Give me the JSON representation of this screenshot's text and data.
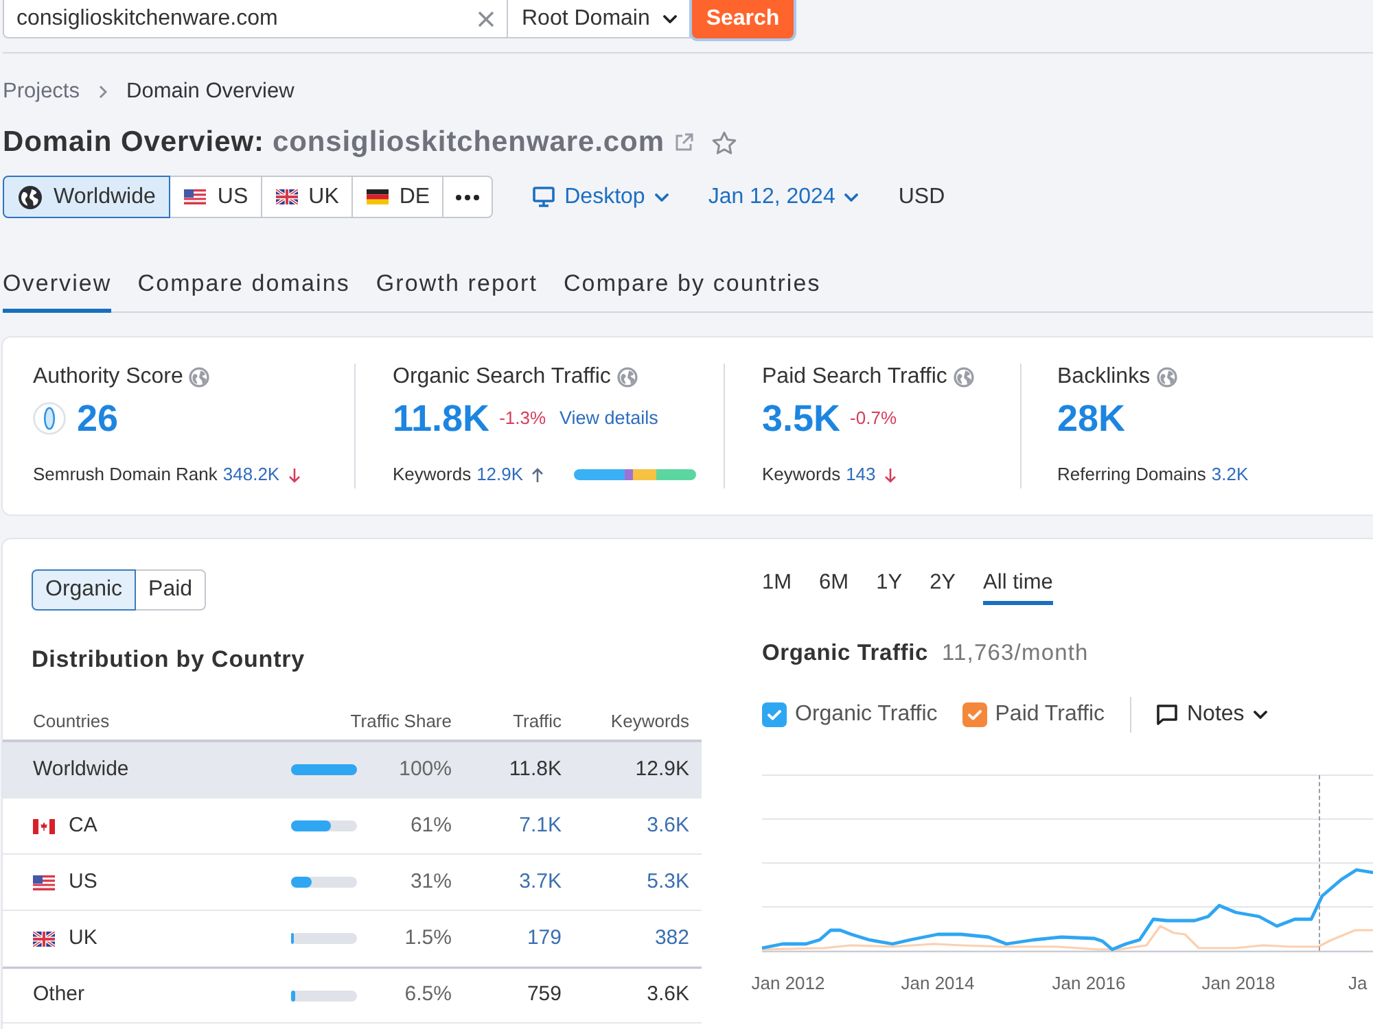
{
  "search": {
    "value": "consiglioskitchenware.com",
    "scope": "Root Domain",
    "button": "Search"
  },
  "breadcrumbs": [
    "Projects",
    "Domain Overview"
  ],
  "title": {
    "label": "Domain Overview:",
    "domain": "consiglioskitchenware.com"
  },
  "regions": [
    {
      "label": "Worldwide",
      "kind": "globe",
      "selected": true
    },
    {
      "label": "US",
      "kind": "us",
      "selected": false
    },
    {
      "label": "UK",
      "kind": "uk",
      "selected": false
    },
    {
      "label": "DE",
      "kind": "de",
      "selected": false
    }
  ],
  "device": "Desktop",
  "date": "Jan 12, 2024",
  "currency": "USD",
  "tabs": [
    {
      "label": "Overview",
      "selected": true
    },
    {
      "label": "Compare domains",
      "selected": false
    },
    {
      "label": "Growth report",
      "selected": false
    },
    {
      "label": "Compare by countries",
      "selected": false
    }
  ],
  "metrics": [
    {
      "kind": "authority",
      "label": "Authority Score",
      "value": "26",
      "footer_label": "Semrush Domain Rank",
      "footer_value": "348.2K",
      "falling": true
    },
    {
      "kind": "organic",
      "label": "Organic Search Traffic",
      "value": "11.8K",
      "change": "-1.3%",
      "link": "View details",
      "footer_label": "Keywords",
      "footer_value": "12.9K",
      "falling": false
    },
    {
      "kind": "paid",
      "label": "Paid Search Traffic",
      "value": "3.5K",
      "change": "-0.7%",
      "footer_label": "Keywords",
      "footer_value": "143",
      "falling": true
    },
    {
      "kind": "backlinks",
      "label": "Backlinks",
      "value": "28K",
      "footer_label": "Referring Domains",
      "footer_value": "3.2K"
    }
  ],
  "distribution": {
    "toggle": [
      {
        "label": "Organic",
        "selected": true
      },
      {
        "label": "Paid",
        "selected": false
      }
    ],
    "title": "Distribution by Country",
    "columns": [
      "Countries",
      "Traffic Share",
      "Traffic",
      "Keywords"
    ],
    "rows": [
      {
        "country": "Worldwide",
        "kind": "total",
        "level": 1,
        "share": "100%",
        "traffic": "11.8K",
        "keywords": "12.9K",
        "selected": true
      },
      {
        "country": "CA",
        "kind": "ca",
        "level": 0.61,
        "share": "61%",
        "traffic": "7.1K",
        "keywords": "3.6K",
        "selected": false
      },
      {
        "country": "US",
        "kind": "us",
        "level": 0.31,
        "share": "31%",
        "traffic": "3.7K",
        "keywords": "5.3K",
        "selected": false
      },
      {
        "country": "UK",
        "kind": "uk",
        "level": 0.015,
        "share": "1.5%",
        "traffic": "179",
        "keywords": "382",
        "selected": false
      },
      {
        "country": "Other",
        "kind": "other",
        "level": 0.065,
        "share": "6.5%",
        "traffic": "759",
        "keywords": "3.6K",
        "selected": false
      }
    ]
  },
  "traffic": {
    "periods": [
      {
        "label": "1M",
        "selected": false
      },
      {
        "label": "6M",
        "selected": false
      },
      {
        "label": "1Y",
        "selected": false
      },
      {
        "label": "2Y",
        "selected": false
      },
      {
        "label": "All time",
        "selected": true
      }
    ],
    "title": "Organic Traffic",
    "total": "11,763/month",
    "legend": [
      {
        "label": "Organic Traffic",
        "checked": true,
        "color": "#2fa6f2"
      },
      {
        "label": "Paid Traffic",
        "checked": true,
        "color": "#f5873a"
      }
    ],
    "notes": "Notes",
    "x_labels": [
      "Jan 2012",
      "Jan 2014",
      "Jan 2016",
      "Jan 2018",
      "Ja"
    ]
  }
}
